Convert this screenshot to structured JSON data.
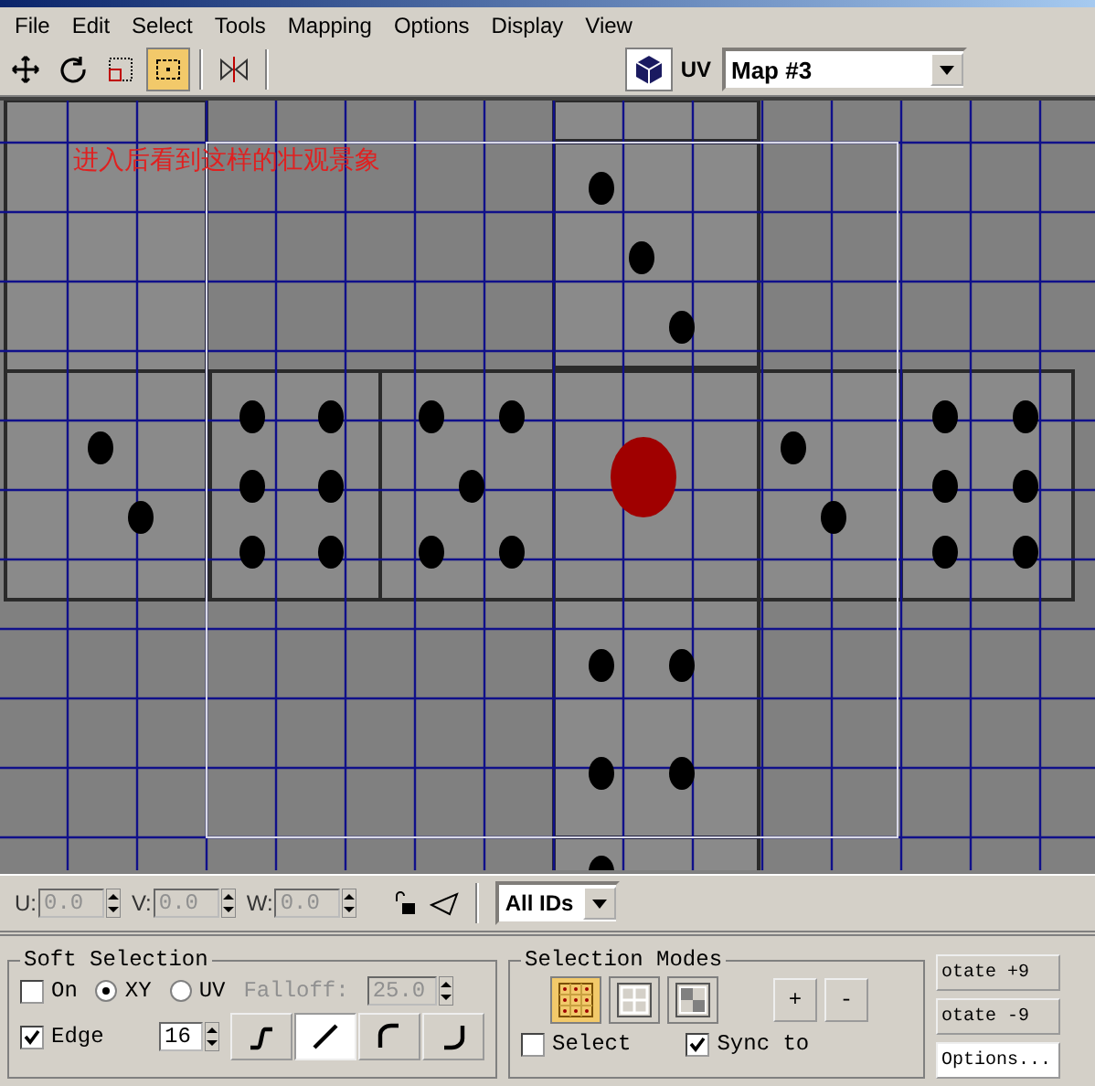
{
  "menu": [
    "File",
    "Edit",
    "Select",
    "Tools",
    "Mapping",
    "Options",
    "Display",
    "View"
  ],
  "tools": [
    {
      "kind": "move",
      "selected": false
    },
    {
      "kind": "rotate",
      "selected": false
    },
    {
      "kind": "scale",
      "selected": false
    },
    {
      "kind": "freeform",
      "selected": true
    },
    {
      "kind": "mirror",
      "selected": false
    }
  ],
  "map_selector": {
    "label": "UV",
    "value": "Map #3"
  },
  "viewport": {
    "annotation": "进入后看到这样的壮观景象"
  },
  "coords": [
    {
      "label": "U:",
      "value": "0.0"
    },
    {
      "label": "V:",
      "value": "0.0"
    },
    {
      "label": "W:",
      "value": "0.0"
    }
  ],
  "id_filter": "All IDs",
  "soft_selection": {
    "title": "Soft Selection",
    "on": {
      "label": "On",
      "checked": false
    },
    "axes": [
      {
        "label": "XY",
        "selected": true
      },
      {
        "label": "UV",
        "selected": false
      }
    ],
    "falloff": {
      "label": "Falloff:",
      "value": "25.0",
      "disabled": true
    },
    "edge": {
      "label": "Edge",
      "checked": true
    },
    "edge_count": "16",
    "curves": [
      {
        "kind": "s",
        "selected": false
      },
      {
        "kind": "line",
        "selected": true
      },
      {
        "kind": "convex",
        "selected": false
      },
      {
        "kind": "concave",
        "selected": false
      }
    ]
  },
  "selection_modes": {
    "title": "Selection Modes",
    "modes": [
      {
        "kind": "vertex",
        "selected": true
      },
      {
        "kind": "edge",
        "selected": false
      },
      {
        "kind": "face",
        "selected": false
      }
    ],
    "buttons": [
      "+",
      "-"
    ],
    "select": {
      "label": "Select",
      "checked": false
    },
    "sync": {
      "label": "Sync to",
      "checked": true
    }
  },
  "side_buttons": [
    "otate +9",
    "otate -9"
  ],
  "options_button": "Options..."
}
